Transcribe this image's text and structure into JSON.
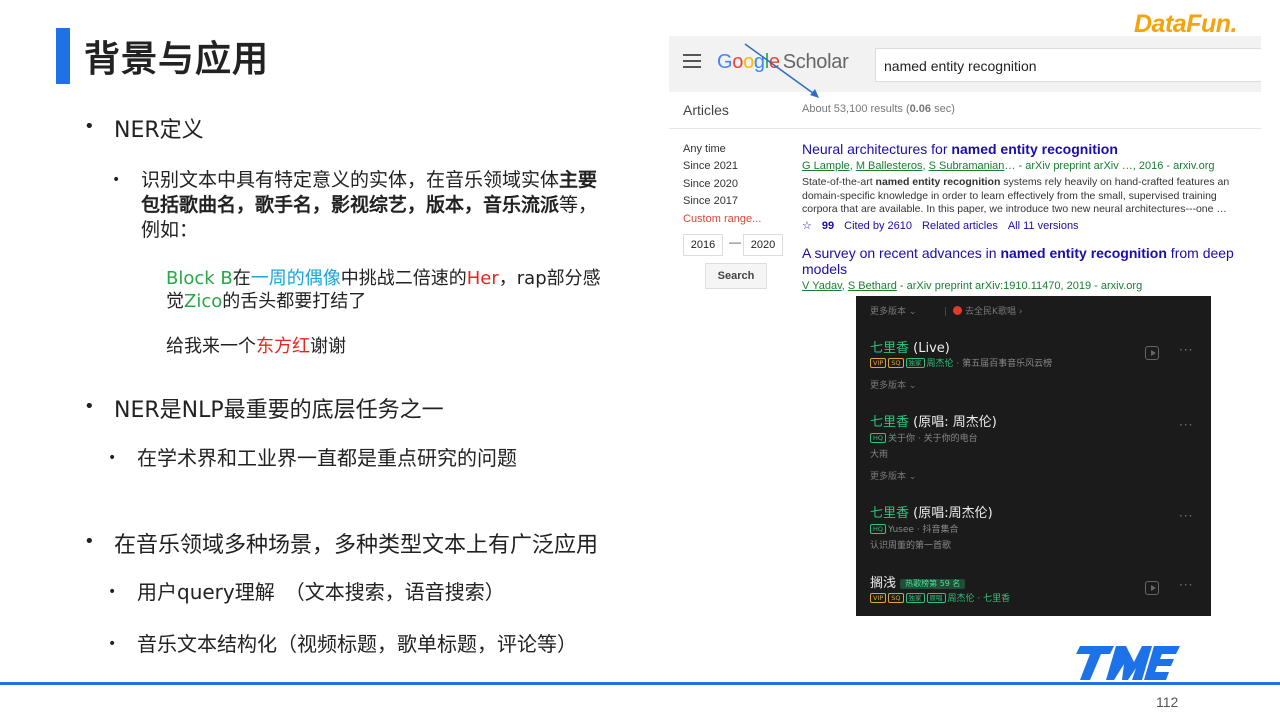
{
  "slide": {
    "title": "背景与应用",
    "brand": "DataFun.",
    "page_number": "112"
  },
  "bullets": {
    "b1": "NER定义",
    "b1_1_pre": "识别文本中具有特定意义的实体，在音乐领域实体",
    "b1_1_bold": "主要包括歌曲名，歌手名，影视综艺，版本，音乐流派",
    "b1_1_post": "等，例如：",
    "ex1": {
      "t1": "Block B",
      "t2": "在",
      "t3": "一周的偶像",
      "t4": "中挑战二倍速的",
      "t5": "Her",
      "t6": "，rap部分感觉",
      "t7": "Zico",
      "t8": "的舌头都要打结了"
    },
    "ex2": {
      "t1": "给我来一个",
      "t2": "东方红",
      "t3": "谢谢"
    },
    "b2": "NER是NLP最重要的底层任务之一",
    "b2_1": "在学术界和工业界一直都是重点研究的问题",
    "b3": "在音乐领域多种场景，多种类型文本上有广泛应用",
    "b3_1": "用户query理解　（文本搜索，语音搜索）",
    "b3_2": "音乐文本结构化（视频标题，歌单标题，评论等）"
  },
  "scholar": {
    "logo_scholar": "Scholar",
    "query": "named entity recognition",
    "articles_label": "Articles",
    "count_pre": "About 53,100 results (",
    "count_time": "0.06",
    "count_post": " sec)",
    "filters": [
      "Any time",
      "Since 2021",
      "Since 2020",
      "Since 2017"
    ],
    "custom_range": "Custom range...",
    "year_from": "2016",
    "year_to": "2020",
    "search_button": "Search",
    "result1": {
      "title_pre": "Neural architectures for ",
      "title_bold": "named entity recognition",
      "authors": [
        "G Lample",
        "M Ballesteros",
        "S Subramanian"
      ],
      "source": "… - arXiv preprint arXiv …, 2016 - arxiv.org",
      "snippet1_pre": "State-of-the-art ",
      "snippet1_bold": "named entity recognition",
      "snippet1_post": " systems rely heavily on hand-crafted features an",
      "snippet2": "domain-specific knowledge in order to learn effectively from the small, supervised training",
      "snippet3": "corpora that are available. In this paper, we introduce two new neural architectures---one …",
      "cited_by": "Cited by 2610",
      "related": "Related articles",
      "versions": "All 11 versions"
    },
    "result2": {
      "title_pre": "A survey on recent advances in ",
      "title_bold": "named entity recognition",
      "title_post": " from deep",
      "title_line2": "models",
      "authors": [
        "V Yadav",
        "S Bethard"
      ],
      "source": " - arXiv preprint arXiv:1910.11470, 2019 - arxiv.org"
    }
  },
  "music": {
    "more_versions": "更多版本",
    "karaoke": "去全民K歌唱",
    "songs": [
      {
        "title": "七里香",
        "suffix": " (Live)",
        "tags": [
          "VIP",
          "SQ",
          "独家"
        ],
        "artist": "周杰伦",
        "album": "第五届百事音乐风云榜"
      },
      {
        "title": "七里香",
        "suffix": " (原唱: 周杰伦)",
        "tags": [
          "HQ"
        ],
        "artist": "关于你",
        "album": "关于你的电台",
        "extra": "大雨"
      },
      {
        "title": "七里香",
        "suffix": " (原唱:周杰伦)",
        "tags": [
          "HQ"
        ],
        "artist": "Yusee",
        "album": "抖音集合",
        "extra": "认识周董的第一首歌"
      },
      {
        "title": "搁浅",
        "hot": "热歌榜第 59 名",
        "tags": [
          "VIP",
          "SQ",
          "独家",
          "原唱"
        ],
        "artist": "周杰伦",
        "album": "七里香"
      }
    ]
  },
  "colors": {
    "accent": "#1e72e8",
    "brand": "#f5a30a",
    "music_green": "#31c27c"
  }
}
